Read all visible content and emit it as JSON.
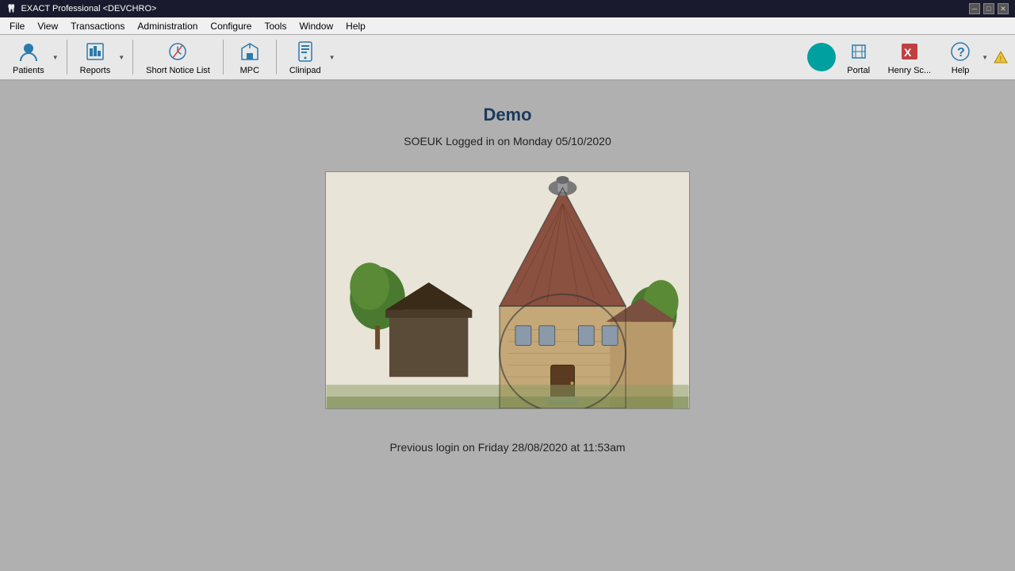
{
  "titlebar": {
    "title": "EXACT Professional <DEVCHRO>",
    "icon": "exact-icon"
  },
  "menubar": {
    "items": [
      "File",
      "View",
      "Transactions",
      "Administration",
      "Configure",
      "Tools",
      "Window",
      "Help"
    ]
  },
  "toolbar": {
    "buttons": [
      {
        "id": "patients",
        "label": "Patients",
        "has_dropdown": true
      },
      {
        "id": "reports",
        "label": "Reports",
        "has_dropdown": true
      },
      {
        "id": "short-notice-list",
        "label": "Short Notice List",
        "has_dropdown": false
      },
      {
        "id": "mpc",
        "label": "MPC",
        "has_dropdown": false
      },
      {
        "id": "clinipad",
        "label": "Clinipad",
        "has_dropdown": true
      }
    ],
    "right_buttons": [
      {
        "id": "portal",
        "label": "Portal",
        "is_circle": true
      },
      {
        "id": "admin",
        "label": "Henry Sc...",
        "has_icon": true
      },
      {
        "id": "help",
        "label": "Help",
        "has_dropdown": true
      },
      {
        "id": "alert",
        "label": "",
        "is_alert": true
      }
    ]
  },
  "main": {
    "demo_title": "Demo",
    "login_info": "SOEUK Logged in on Monday 05/10/2020",
    "prev_login": "Previous login on Friday 28/08/2020 at 11:53am"
  }
}
